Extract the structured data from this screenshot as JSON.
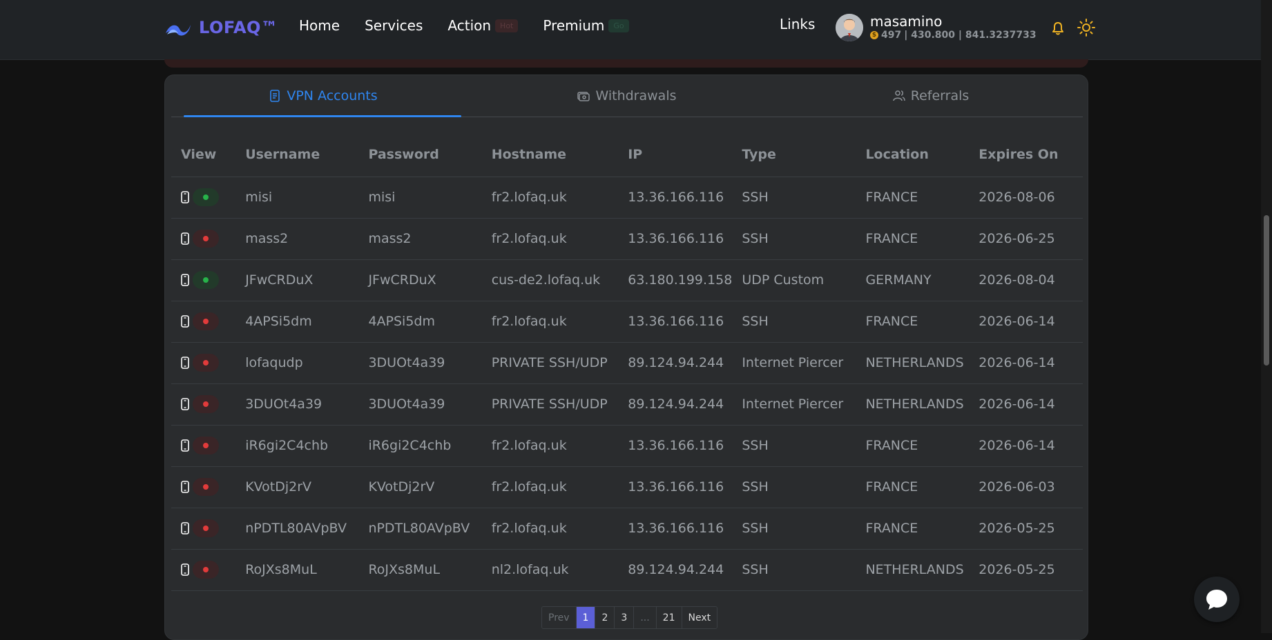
{
  "header": {
    "brand": "LOFAQ™",
    "nav": [
      {
        "label": "Home"
      },
      {
        "label": "Services"
      },
      {
        "label": "Action",
        "badge": "Hot"
      },
      {
        "label": "Premium",
        "badge": "Go"
      }
    ],
    "links_label": "Links",
    "user": {
      "name": "masamino",
      "coins": "497",
      "stats": "| 430.800 | 841.3237733"
    }
  },
  "tabs": [
    {
      "label": "VPN Accounts",
      "icon": "document-icon",
      "active": true
    },
    {
      "label": "Withdrawals",
      "icon": "cash-icon",
      "active": false
    },
    {
      "label": "Referrals",
      "icon": "users-icon",
      "active": false
    }
  ],
  "table": {
    "columns": [
      "View",
      "Username",
      "Password",
      "Hostname",
      "IP",
      "Type",
      "Location",
      "Expires On"
    ],
    "rows": [
      {
        "status": "on",
        "username": "misi",
        "password": "misi",
        "hostname": "fr2.lofaq.uk",
        "ip": "13.36.166.116",
        "type": "SSH",
        "location": "FRANCE",
        "expires": "2026-08-06"
      },
      {
        "status": "off",
        "username": "mass2",
        "password": "mass2",
        "hostname": "fr2.lofaq.uk",
        "ip": "13.36.166.116",
        "type": "SSH",
        "location": "FRANCE",
        "expires": "2026-06-25"
      },
      {
        "status": "on",
        "username": "JFwCRDuX",
        "password": "JFwCRDuX",
        "hostname": "cus-de2.lofaq.uk",
        "ip": "63.180.199.158",
        "type": "UDP Custom",
        "location": "GERMANY",
        "expires": "2026-08-04"
      },
      {
        "status": "off",
        "username": "4APSi5dm",
        "password": "4APSi5dm",
        "hostname": "fr2.lofaq.uk",
        "ip": "13.36.166.116",
        "type": "SSH",
        "location": "FRANCE",
        "expires": "2026-06-14"
      },
      {
        "status": "off",
        "username": "lofaqudp",
        "password": "3DUOt4a39",
        "hostname": "PRIVATE SSH/UDP",
        "ip": "89.124.94.244",
        "type": "Internet Piercer",
        "location": "NETHERLANDS",
        "expires": "2026-06-14"
      },
      {
        "status": "off",
        "username": "3DUOt4a39",
        "password": "3DUOt4a39",
        "hostname": "PRIVATE SSH/UDP",
        "ip": "89.124.94.244",
        "type": "Internet Piercer",
        "location": "NETHERLANDS",
        "expires": "2026-06-14"
      },
      {
        "status": "off",
        "username": "iR6gi2C4chb",
        "password": "iR6gi2C4chb",
        "hostname": "fr2.lofaq.uk",
        "ip": "13.36.166.116",
        "type": "SSH",
        "location": "FRANCE",
        "expires": "2026-06-14"
      },
      {
        "status": "off",
        "username": "KVotDj2rV",
        "password": "KVotDj2rV",
        "hostname": "fr2.lofaq.uk",
        "ip": "13.36.166.116",
        "type": "SSH",
        "location": "FRANCE",
        "expires": "2026-06-03"
      },
      {
        "status": "off",
        "username": "nPDTL80AVpBV",
        "password": "nPDTL80AVpBV",
        "hostname": "fr2.lofaq.uk",
        "ip": "13.36.166.116",
        "type": "SSH",
        "location": "FRANCE",
        "expires": "2026-05-25"
      },
      {
        "status": "off",
        "username": "RoJXs8MuL",
        "password": "RoJXs8MuL",
        "hostname": "nl2.lofaq.uk",
        "ip": "89.124.94.244",
        "type": "SSH",
        "location": "NETHERLANDS",
        "expires": "2026-05-25"
      }
    ]
  },
  "pagination": {
    "prev": "Prev",
    "pages": [
      "1",
      "2",
      "3",
      "...",
      "21"
    ],
    "current": "1",
    "next": "Next"
  },
  "colors": {
    "accent": "#2f86f0",
    "brand": "#6a66e6",
    "status_on": "#27b34a",
    "status_off": "#e23b3b",
    "page_active": "#5b5fd6"
  }
}
